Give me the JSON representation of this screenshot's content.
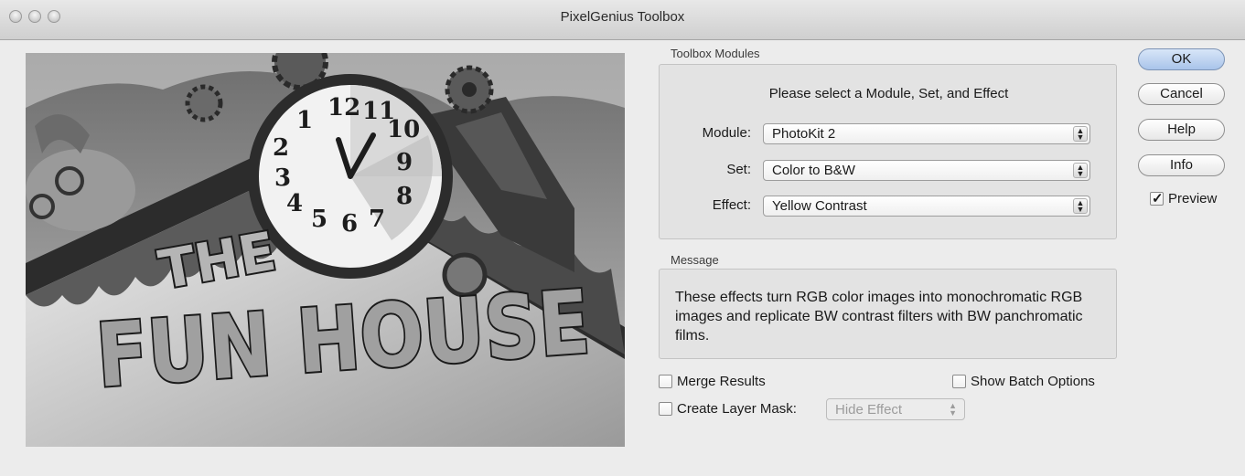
{
  "window": {
    "title": "PixelGenius Toolbox"
  },
  "modules": {
    "group_label": "Toolbox Modules",
    "prompt": "Please select a Module, Set, and Effect",
    "module_label": "Module:",
    "module_value": "PhotoKit 2",
    "set_label": "Set:",
    "set_value": "Color to B&W",
    "effect_label": "Effect:",
    "effect_value": "Yellow Contrast"
  },
  "message": {
    "group_label": "Message",
    "text": "These effects turn RGB color images into monochromatic RGB images and replicate BW contrast filters with BW panchromatic films."
  },
  "options": {
    "merge_results": {
      "label": "Merge Results",
      "checked": false
    },
    "show_batch": {
      "label": "Show Batch Options",
      "checked": false
    },
    "layer_mask": {
      "label": "Create Layer Mask:",
      "checked": false
    },
    "layer_mask_select": "Hide Effect"
  },
  "buttons": {
    "ok": "OK",
    "cancel": "Cancel",
    "help": "Help",
    "info": "Info"
  },
  "preview_checkbox": {
    "label": "Preview",
    "checked": true
  },
  "preview_image": {
    "sign_line1": "THE",
    "sign_line2": "FUN HOUSE",
    "clock_numbers": [
      "12",
      "11",
      "10",
      "9",
      "8",
      "7",
      "6",
      "5",
      "4",
      "3",
      "2",
      "1"
    ]
  },
  "icons": {
    "traffic": [
      "close-icon",
      "minimize-icon",
      "zoom-icon"
    ],
    "popup_arrows": "updown-arrows-icon",
    "check": "checkmark-icon"
  }
}
